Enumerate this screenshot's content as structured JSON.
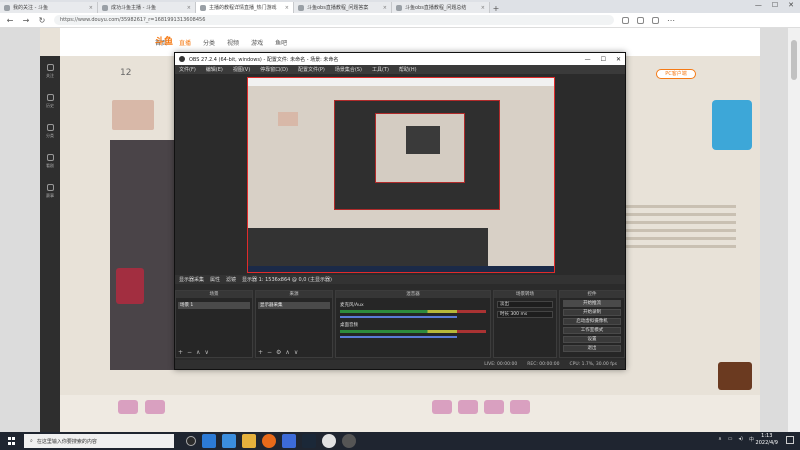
{
  "browser": {
    "tabs": [
      {
        "label": "我的关注 - 斗鱼",
        "active": false
      },
      {
        "label": "成功斗鱼主播 - 斗鱼",
        "active": false
      },
      {
        "label": "主播的教程详情直播_热门游戏",
        "active": true
      },
      {
        "label": "斗鱼obs直播教程_问题答案",
        "active": false
      },
      {
        "label": "斗鱼obs直播教程_问题总结",
        "active": false
      }
    ],
    "new_tab": "+",
    "url": "https://www.douyu.com/3598261?_r=1681991313608456",
    "window_controls": [
      "—",
      "☐",
      "✕"
    ]
  },
  "site": {
    "logo": "斗鱼",
    "nav": [
      "首页",
      "直播",
      "分类",
      "视频",
      "游戏",
      "鱼吧"
    ],
    "active_nav": "直播",
    "fans_count": "12",
    "pc_button": "PC客户端",
    "rail": [
      "关注",
      "历史",
      "分类",
      "看剧",
      "赛事"
    ]
  },
  "obs": {
    "title": "OBS 27.2.4 (64-bit, windows) - 配置文件: 未命名 - 场景: 未命名",
    "menu": [
      "文件(F)",
      "编辑(E)",
      "视图(V)",
      "停靠窗口(D)",
      "配置文件(P)",
      "场景集合(S)",
      "工具(T)",
      "帮助(H)"
    ],
    "source_toolbar": [
      "显示器采集",
      "属性",
      "滤镜",
      "显示器 1: 1536x864 @ 0,0 (主显示器)"
    ],
    "docks": {
      "scenes": {
        "title": "场景",
        "items": [
          "场景 1"
        ]
      },
      "sources": {
        "title": "来源",
        "items": [
          "显示器采集"
        ]
      },
      "mixer": {
        "title": "混音器",
        "tracks": [
          "桌面音频",
          "麦克风/Aux"
        ]
      },
      "transitions": {
        "title": "场景转场",
        "type": "淡出",
        "duration_label": "时长",
        "duration": "300 ms"
      },
      "controls": {
        "title": "控件",
        "buttons": [
          "开始推流",
          "开始录制",
          "启动虚拟摄像机",
          "工作室模式",
          "设置",
          "退出"
        ]
      }
    },
    "status": [
      "LIVE: 00:00:00",
      "REC: 00:00:00",
      "CPU: 1.7%, 30.00 fps"
    ]
  },
  "taskbar": {
    "search_placeholder": "在这里输入你要搜索的内容",
    "time": "1:13",
    "date": "2022/4/9",
    "lang": "中"
  }
}
